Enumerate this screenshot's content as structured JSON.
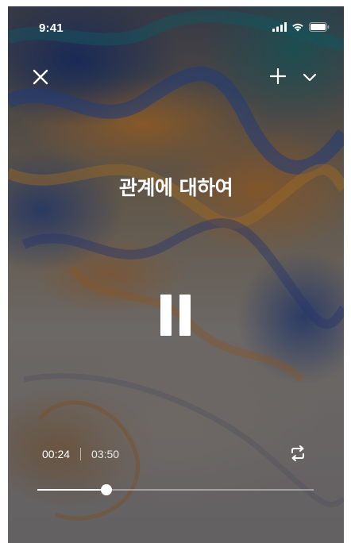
{
  "status_bar": {
    "time": "9:41",
    "icons": [
      "signal-icon",
      "wifi-icon",
      "battery-icon"
    ]
  },
  "header": {
    "close_icon": "close-icon",
    "add_icon": "plus-icon",
    "collapse_icon": "chevron-down-icon"
  },
  "track": {
    "title": "관계에 대하여"
  },
  "player": {
    "state_icon": "pause-icon",
    "current_time": "00:24",
    "total_time": "03:50",
    "repeat_icon": "repeat-icon",
    "progress_fraction": 0.25
  },
  "colors": {
    "foreground": "#ffffff",
    "track_background": "#ffffff66"
  }
}
